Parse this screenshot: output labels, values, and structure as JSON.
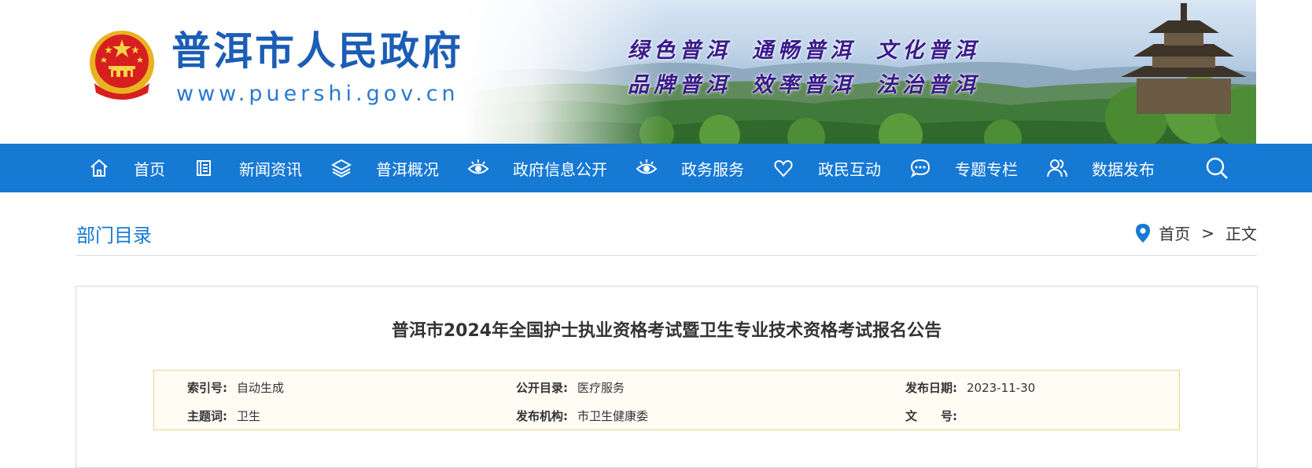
{
  "header": {
    "site_name": "普洱市人民政府",
    "site_url": "www.puershi.gov.cn",
    "slogan_line1": [
      "绿色普洱",
      "通畅普洱",
      "文化普洱"
    ],
    "slogan_line2": [
      "品牌普洱",
      "效率普洱",
      "法治普洱"
    ],
    "emblem_icon": "national-emblem"
  },
  "nav": {
    "items": [
      {
        "label": "首页",
        "icon": "home-icon"
      },
      {
        "label": "新闻资讯",
        "icon": "book-icon"
      },
      {
        "label": "普洱概况",
        "icon": "layers-icon"
      },
      {
        "label": "政府信息公开",
        "icon": "eye-icon"
      },
      {
        "label": "政务服务",
        "icon": "eye-icon"
      },
      {
        "label": "政民互动",
        "icon": "heart-icon"
      },
      {
        "label": "专题专栏",
        "icon": "chat-icon"
      },
      {
        "label": "数据发布",
        "icon": "users-icon"
      }
    ],
    "search_icon": "search-icon",
    "bg_color": "#1679d4"
  },
  "page": {
    "section_title": "部门目录",
    "breadcrumb": {
      "home": "首页",
      "separator": ">",
      "current": "正文"
    }
  },
  "article": {
    "title": "普洱市2024年全国护士执业资格考试暨卫生专业技术资格考试报名公告",
    "meta": {
      "index_no_label": "索引号:",
      "index_no": "自动生成",
      "catalog_label": "公开目录:",
      "catalog": "医疗服务",
      "date_label": "发布日期:",
      "date": "2023-11-30",
      "topic_label": "主题词:",
      "topic": "卫生",
      "org_label": "发布机构:",
      "org": "市卫生健康委",
      "doc_no_label": "文　　号:",
      "doc_no": ""
    }
  }
}
